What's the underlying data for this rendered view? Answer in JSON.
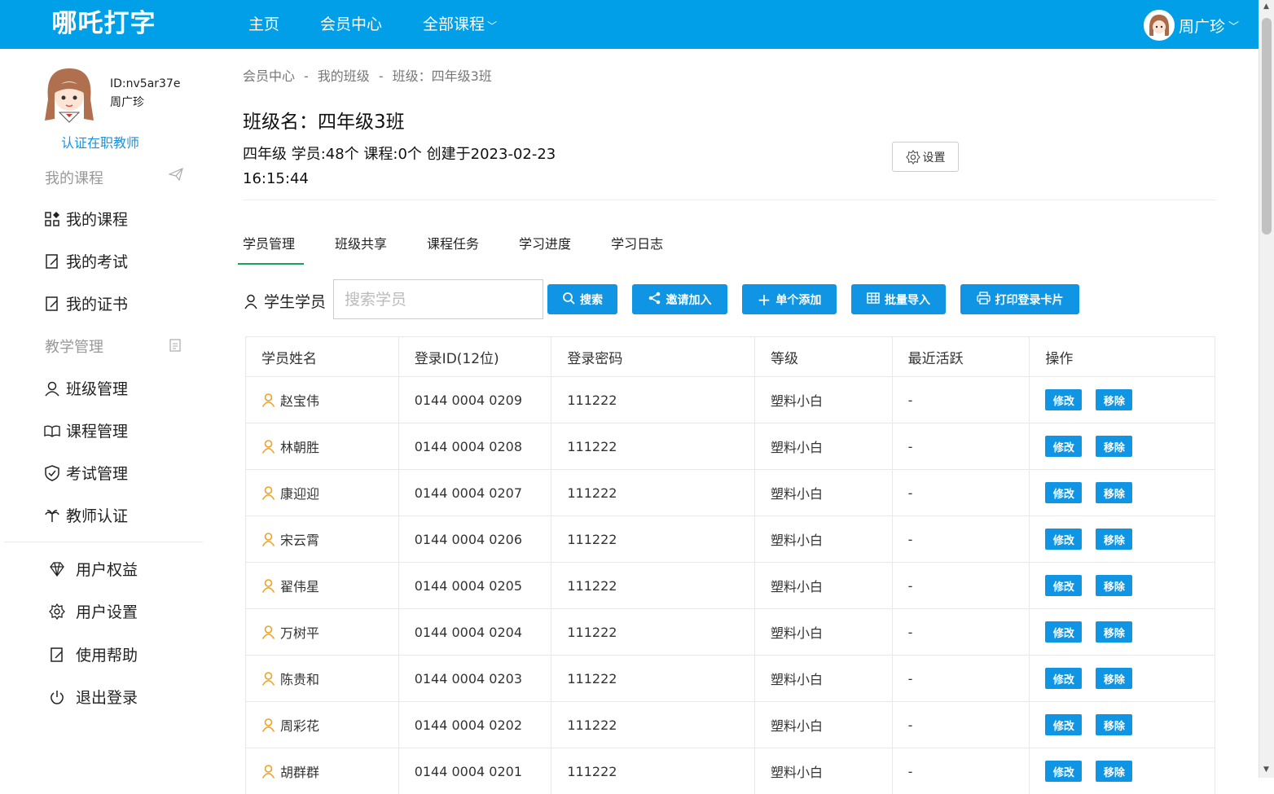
{
  "app": {
    "brand": "哪吒打字"
  },
  "nav": {
    "items": [
      "主页",
      "会员中心",
      "全部课程"
    ],
    "user_name": "周广珍"
  },
  "sidebar": {
    "user_id": "ID:nv5ar37e",
    "user_name": "周广珍",
    "verify_label": "认证在职教师",
    "section_courses": "我的课程",
    "course_items": [
      "我的课程",
      "我的考试",
      "我的证书"
    ],
    "section_teaching": "教学管理",
    "teaching_items": [
      "班级管理",
      "课程管理",
      "考试管理",
      "教师认证"
    ],
    "account_items": [
      "用户权益",
      "用户设置",
      "使用帮助",
      "退出登录"
    ]
  },
  "breadcrumb": [
    "会员中心",
    "我的班级",
    "班级：四年级3班"
  ],
  "class": {
    "title": "班级名：四年级3班",
    "info": "四年级 学员:48个 课程:0个 创建于2023-02-23 16:15:44",
    "settings_label": "设置"
  },
  "tabs": [
    "学员管理",
    "班级共享",
    "课程任务",
    "学习进度",
    "学习日志"
  ],
  "toolbar": {
    "student_label": "学生学员",
    "search_placeholder": "搜索学员",
    "search_btn": "搜索",
    "invite_btn": "邀请加入",
    "add_btn": "单个添加",
    "import_btn": "批量导入",
    "print_btn": "打印登录卡片"
  },
  "table": {
    "headers": [
      "学员姓名",
      "登录ID(12位)",
      "登录密码",
      "等级",
      "最近活跃",
      "操作"
    ],
    "edit_label": "修改",
    "remove_label": "移除",
    "rows": [
      {
        "name": "赵宝伟",
        "id": "0144 0004 0209",
        "pwd": "111222",
        "level": "塑料小白",
        "active": "-"
      },
      {
        "name": "林朝胜",
        "id": "0144 0004 0208",
        "pwd": "111222",
        "level": "塑料小白",
        "active": "-"
      },
      {
        "name": "康迎迎",
        "id": "0144 0004 0207",
        "pwd": "111222",
        "level": "塑料小白",
        "active": "-"
      },
      {
        "name": "宋云霄",
        "id": "0144 0004 0206",
        "pwd": "111222",
        "level": "塑料小白",
        "active": "-"
      },
      {
        "name": "翟伟星",
        "id": "0144 0004 0205",
        "pwd": "111222",
        "level": "塑料小白",
        "active": "-"
      },
      {
        "name": "万树平",
        "id": "0144 0004 0204",
        "pwd": "111222",
        "level": "塑料小白",
        "active": "-"
      },
      {
        "name": "陈贵和",
        "id": "0144 0004 0203",
        "pwd": "111222",
        "level": "塑料小白",
        "active": "-"
      },
      {
        "name": "周彩花",
        "id": "0144 0004 0202",
        "pwd": "111222",
        "level": "塑料小白",
        "active": "-"
      },
      {
        "name": "胡群群",
        "id": "0144 0004 0201",
        "pwd": "111222",
        "level": "塑料小白",
        "active": "-"
      }
    ]
  },
  "colors": {
    "brand": "#009fe8",
    "button": "#0f95e3",
    "tab_active": "#19a35a",
    "person_icon": "#f0a020"
  }
}
